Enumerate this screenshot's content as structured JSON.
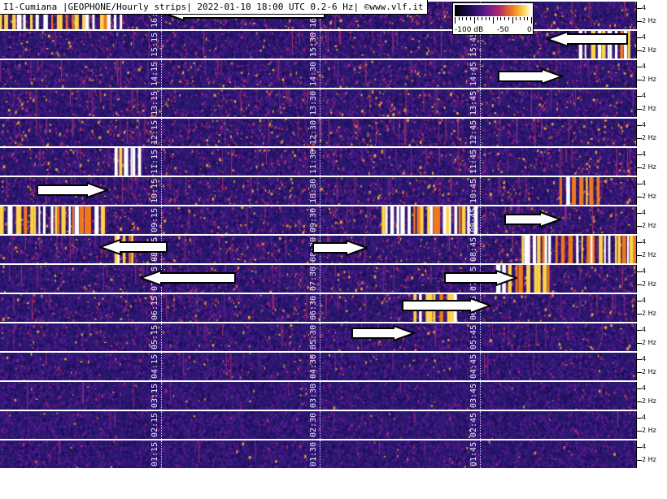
{
  "header": {
    "title": "I1-Cumiana |GEOPHONE/Hourly strips| 2022-01-10 18:00 UTC 0.2-6 Hz| ©www.vlf.it"
  },
  "legend": {
    "min_label": "-100 dB",
    "mid_label": "-50",
    "max_label": "0",
    "colors": [
      "#000000",
      "#1e0c5a",
      "#5a1a90",
      "#b02a6a",
      "#f07820",
      "#ffd24a",
      "#ffffff"
    ]
  },
  "axis": {
    "upper_label": "4",
    "lower_label": "2 Hz"
  },
  "strips": [
    {
      "labels": [
        "16:15",
        "16:30",
        "16:45"
      ],
      "activity": 0.55,
      "bursts": [
        [
          0.0,
          0.19,
          1.0
        ]
      ]
    },
    {
      "labels": [
        "15:15",
        "15:30",
        "15:45"
      ],
      "activity": 0.4,
      "bursts": [
        [
          0.91,
          0.99,
          1.0
        ]
      ]
    },
    {
      "labels": [
        "14:15",
        "14:30",
        "14:45"
      ],
      "activity": 0.45,
      "bursts": []
    },
    {
      "labels": [
        "13:15",
        "13:30",
        "13:45"
      ],
      "activity": 0.55,
      "bursts": []
    },
    {
      "labels": [
        "12:15",
        "12:30",
        "12:45"
      ],
      "activity": 0.6,
      "bursts": []
    },
    {
      "labels": [
        "11:15",
        "11:30",
        "11:45"
      ],
      "activity": 0.5,
      "bursts": [
        [
          0.18,
          0.22,
          1.0
        ]
      ]
    },
    {
      "labels": [
        "10:15",
        "10:30",
        "10:45"
      ],
      "activity": 0.55,
      "bursts": [
        [
          0.88,
          0.94,
          0.9
        ]
      ]
    },
    {
      "labels": [
        "09:15",
        "09:30",
        "09:45"
      ],
      "activity": 0.5,
      "bursts": [
        [
          0.0,
          0.16,
          1.0
        ],
        [
          0.6,
          0.75,
          1.0
        ]
      ]
    },
    {
      "labels": [
        "08:15",
        "08:30",
        "08:45"
      ],
      "activity": 0.55,
      "bursts": [
        [
          0.18,
          0.21,
          0.8
        ],
        [
          0.82,
          1.0,
          1.0
        ]
      ]
    },
    {
      "labels": [
        "07:15",
        "07:30",
        "07:45"
      ],
      "activity": 0.45,
      "bursts": [
        [
          0.78,
          0.87,
          1.0
        ]
      ]
    },
    {
      "labels": [
        "06:15",
        "06:30",
        "06:45"
      ],
      "activity": 0.45,
      "bursts": [
        [
          0.65,
          0.72,
          0.8
        ]
      ]
    },
    {
      "labels": [
        "05:15",
        "05:30",
        "05:45"
      ],
      "activity": 0.3,
      "bursts": []
    },
    {
      "labels": [
        "04:15",
        "04:30",
        "04:45"
      ],
      "activity": 0.2,
      "bursts": []
    },
    {
      "labels": [
        "03:15",
        "03:30",
        "03:45"
      ],
      "activity": 0.12,
      "bursts": []
    },
    {
      "labels": [
        "02:15",
        "02:30",
        "02:45"
      ],
      "activity": 0.08,
      "bursts": []
    },
    {
      "labels": [
        "01:15",
        "01:30",
        "01:45"
      ],
      "activity": 0.1,
      "bursts": []
    }
  ],
  "arrows": [
    {
      "strip": 0,
      "direction": "left"
    },
    {
      "strip": 1,
      "direction": "left"
    },
    {
      "strip": 2,
      "direction": "right"
    },
    {
      "strip": 6,
      "direction": "right"
    },
    {
      "strip": 7,
      "direction": "right"
    },
    {
      "strip": 8,
      "direction": "left"
    },
    {
      "strip": 8,
      "direction": "right"
    },
    {
      "strip": 9,
      "direction": "left"
    },
    {
      "strip": 9,
      "direction": "right"
    },
    {
      "strip": 10,
      "direction": "right"
    },
    {
      "strip": 11,
      "direction": "right"
    }
  ]
}
